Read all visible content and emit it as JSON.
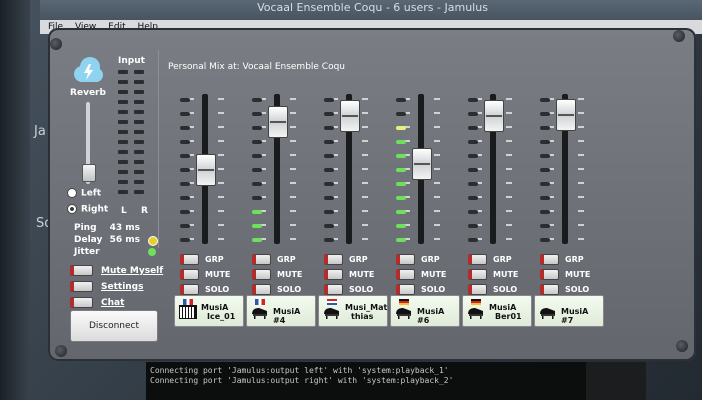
{
  "window": {
    "title": "Vocaal Ensemble Coqu - 6 users - Jamulus"
  },
  "menu": [
    "File",
    "View",
    "Edit",
    "Help"
  ],
  "desktop": {
    "label_a": "Ja",
    "label_b": "So"
  },
  "left_panel": {
    "reverb_label": "Reverb",
    "input_label": "Input",
    "left_label": "Left",
    "right_label": "Right",
    "meter_l": "L",
    "meter_r": "R",
    "ping_label": "Ping",
    "ping_value": "43 ms",
    "delay_label": "Delay",
    "delay_value": "56 ms",
    "jitter_label": "Jitter",
    "mute_myself": "Mute Myself",
    "settings": "Settings",
    "chat": "Chat",
    "disconnect": "Disconnect"
  },
  "mixer": {
    "title": "Personal Mix at: Vocaal Ensemble Coqu",
    "btn_grp": "GRP",
    "btn_mute": "MUTE",
    "btn_solo": "SOLO",
    "channels": [
      {
        "name_line1": "MusiA",
        "name_line2": "Ice_01",
        "fader_level": 0.5,
        "meter_level": 0.0,
        "instrument": "keyboard-icon",
        "flag": "iceland"
      },
      {
        "name_line1": "MusiA #4",
        "name_line2": "",
        "fader_level": 0.9,
        "meter_level": 0.3,
        "instrument": "piano-icon",
        "flag": "france"
      },
      {
        "name_line1": "Musi_Mat",
        "name_line2": "thias",
        "fader_level": 0.95,
        "meter_level": 0.0,
        "instrument": "piano-icon",
        "flag": "netherlands"
      },
      {
        "name_line1": "MusiA #6",
        "name_line2": "",
        "fader_level": 0.55,
        "meter_level": 0.85,
        "instrument": "piano-icon",
        "flag": "germany"
      },
      {
        "name_line1": "MusiA",
        "name_line2": "Ber01",
        "fader_level": 0.95,
        "meter_level": 0.0,
        "instrument": "piano-icon",
        "flag": "germany"
      },
      {
        "name_line1": "MusiA #7",
        "name_line2": "",
        "fader_level": 0.96,
        "meter_level": 0.0,
        "instrument": "piano-icon",
        "flag": ""
      }
    ]
  },
  "terminal": {
    "line1": "Connecting port 'Jamulus:output left' with 'system:playback_1'",
    "line2": "Connecting port 'Jamulus:output right' with 'system:playback_2'"
  },
  "colors": {
    "panel": "#6e7278",
    "led_green": "#6ee05a",
    "led_yellow": "#e8f07a",
    "led_red": "#b32c2c"
  }
}
